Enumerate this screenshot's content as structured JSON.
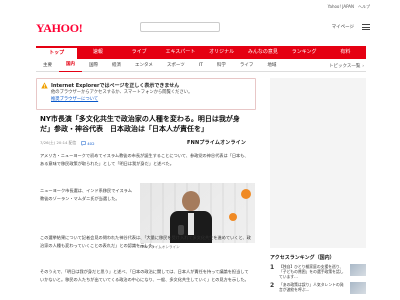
{
  "util": {
    "links": "Yahoo! JAPAN　ヘルプ"
  },
  "header": {
    "logo": "YAHOO!",
    "mypage": "マイページ",
    "menu_label": "メニュー"
  },
  "gnav": {
    "items": [
      "トップ",
      "速報",
      "ライブ",
      "エキスパート",
      "オリジナル",
      "みんなの意見",
      "ランキング",
      "有料"
    ],
    "active_index": 0
  },
  "snav": {
    "items": [
      "主要",
      "国内",
      "国際",
      "経済",
      "エンタメ",
      "スポーツ",
      "IT",
      "科学",
      "ライフ",
      "地域"
    ],
    "active_index": 1,
    "topics": "トピックス一覧"
  },
  "notice": {
    "title": "Internet Explorerではページを正しく表示できません",
    "body": "他のブラウザーからアクセスするか、スマートフォンから閲覧ください。",
    "link": "推奨ブラウザーについて"
  },
  "article": {
    "headline": "NY市長演「多文化共生で政治家の人種を変わる。明日は我が身だ」参政・神谷代表　日本政治は「日本人が責任を」",
    "date": "7/26(土) 20:14 配信",
    "comments": "402",
    "provider": "FNNプライムオンライン",
    "p1": "アメリカ・ニューヨークで初めてイスラム教徒の市長が誕生することについて、参政党の神谷代表は「日本も、ある意味で移民政策が取られた」として「明日は我が身だ」と述べた。",
    "p2": "ニューヨーク市長選は、インド系移民でイスラム教徒のゾーラン・マムダニ氏が当選した。",
    "p3": "この選挙結果について記者会見の問われた神谷代表は、「大量に移民を受け入れて多文化共生を進めていくと、政治家の人種も変わっていくことの表れだ」との認識を示した。",
    "p4": "そのうえで、「明日は我が身だと思う」と述べ、「日本の政治に関しては、日本人が責任を持って議論を担当していかないと。移民の人たちが出ていてくる政治の中心になり、一般、多文化共生していく」との見方を示した。",
    "photo_caption": "FNNプライムオンライン"
  },
  "sidebar": {
    "access_title": "アクセスランキング（国内）",
    "rank": [
      {
        "num": "1",
        "text": "【独自】ひとり親家庭の支援を巡り、「子どもの貧困」をの選手政策を話しています…"
      },
      {
        "num": "2",
        "text": "「あの政策は誤り」人気タレントの発言が波紋を呼ぶ…"
      }
    ]
  }
}
